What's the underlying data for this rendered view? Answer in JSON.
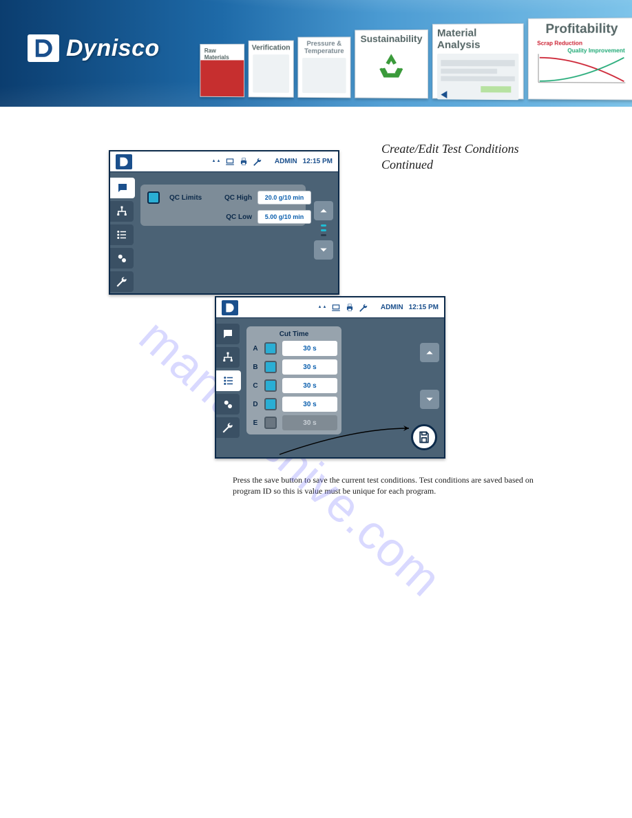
{
  "banner": {
    "brand": "Dynisco",
    "cards": [
      {
        "label": "Raw Materials"
      },
      {
        "label": "Verification"
      },
      {
        "label": "Pressure & Temperature"
      },
      {
        "label": "Sustainability"
      },
      {
        "label": "Material Analysis"
      },
      {
        "label": "Profitability",
        "sub1": "Scrap Reduction",
        "sub2": "Quality Improvement"
      }
    ]
  },
  "page": {
    "title_line1": "Create/Edit Test Conditions",
    "title_line2": "Continued",
    "caption": "Press the save button to save the current test conditions. Test conditions are saved based on program ID so this is value must be unique for each program."
  },
  "watermark": "manualshive.com",
  "device_header": {
    "user": "ADMIN",
    "time": "12:15 PM"
  },
  "qc": {
    "title": "QC Limits",
    "high_label": "QC High",
    "high_value": "20.0 g/10 min",
    "low_label": "QC Low",
    "low_value": "5.00 g/10 min"
  },
  "cut": {
    "title": "Cut Time",
    "rows": [
      {
        "label": "A",
        "value": "30 s",
        "enabled": true
      },
      {
        "label": "B",
        "value": "30 s",
        "enabled": true
      },
      {
        "label": "C",
        "value": "30 s",
        "enabled": true
      },
      {
        "label": "D",
        "value": "30 s",
        "enabled": true
      },
      {
        "label": "E",
        "value": "30 s",
        "enabled": false
      }
    ]
  }
}
